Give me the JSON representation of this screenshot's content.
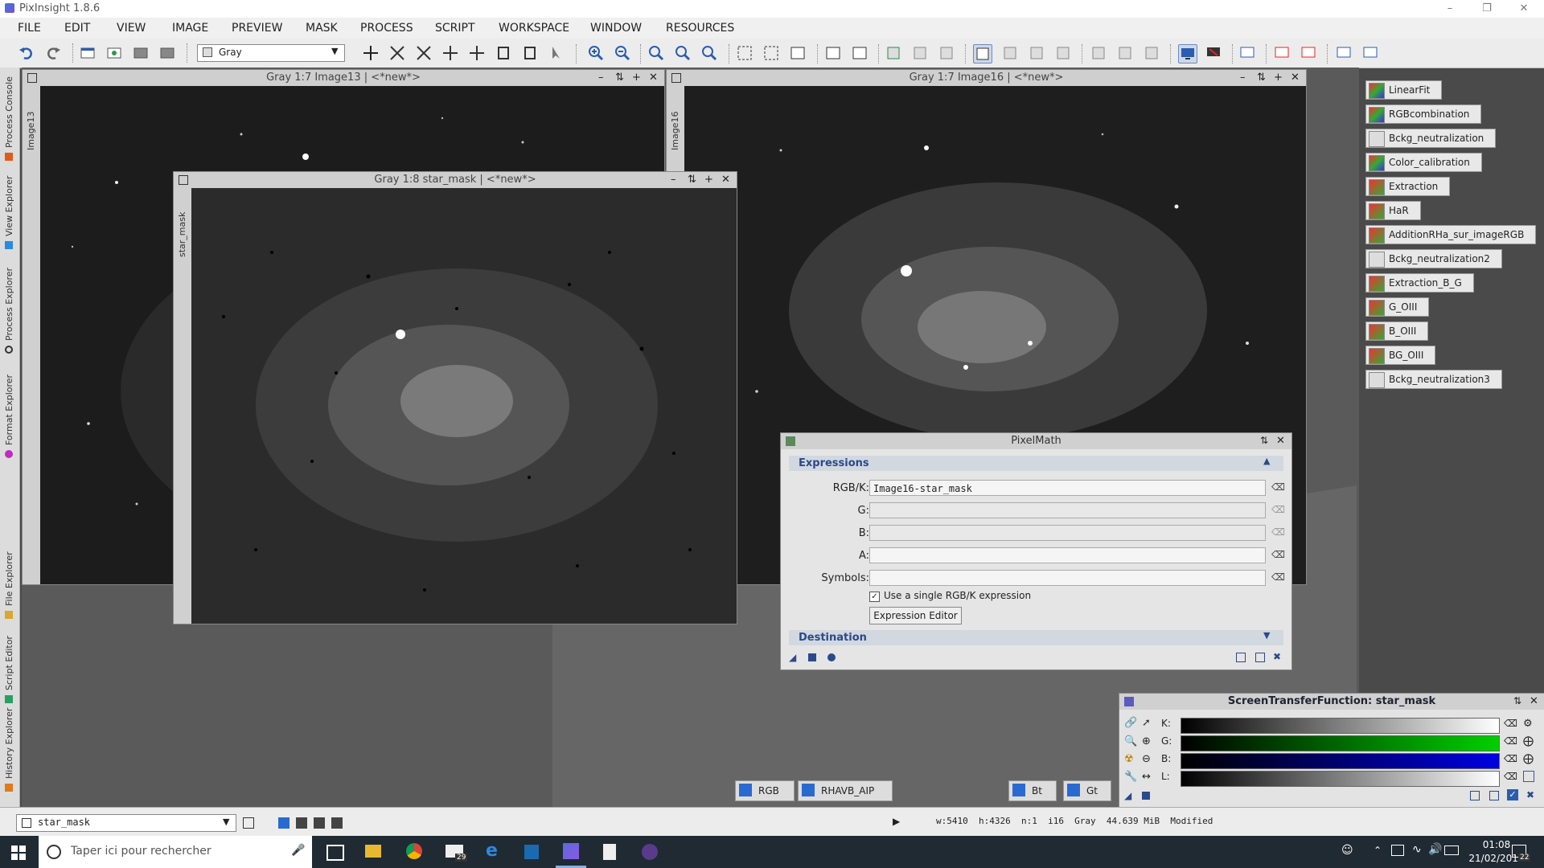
{
  "app": {
    "title": "PixInsight 1.8.6"
  },
  "menu": [
    "FILE",
    "EDIT",
    "VIEW",
    "IMAGE",
    "PREVIEW",
    "MASK",
    "PROCESS",
    "SCRIPT",
    "WORKSPACE",
    "WINDOW",
    "RESOURCES"
  ],
  "toolbar": {
    "display_select": "Gray"
  },
  "sidebar_tabs": [
    "Process Console",
    "View Explorer",
    "Process Explorer",
    "Format Explorer",
    "File Explorer",
    "Script Editor",
    "History Explorer"
  ],
  "windows": {
    "image13": {
      "title": "Gray 1:7 Image13 | <*new*>",
      "tab": "Image13"
    },
    "image16": {
      "title": "Gray 1:7 Image16 | <*new*>",
      "tab": "Image16"
    },
    "starmask": {
      "title": "Gray 1:8 star_mask | <*new*>",
      "tab": "star_mask"
    }
  },
  "process_icons": [
    "LinearFit",
    "RGBcombination",
    "Bckg_neutralization",
    "Color_calibration",
    "Extraction",
    "HaR",
    "AdditionRHa_sur_imageRGB",
    "Bckg_neutralization2",
    "Extraction_B_G",
    "G_OIII",
    "B_OIII",
    "BG_OIII",
    "Bckg_neutralization3"
  ],
  "pixelmath": {
    "title": "PixelMath",
    "expressions_label": "Expressions",
    "rows": [
      {
        "label": "RGB/K:",
        "value": "Image16-star_mask"
      },
      {
        "label": "G:",
        "value": ""
      },
      {
        "label": "B:",
        "value": ""
      },
      {
        "label": "A:",
        "value": ""
      },
      {
        "label": "Symbols:",
        "value": ""
      }
    ],
    "single_expr_label": "Use a single RGB/K expression",
    "single_expr_checked": true,
    "editor_button": "Expression Editor",
    "destination_label": "Destination"
  },
  "stf": {
    "title": "ScreenTransferFunction: star_mask",
    "channels": [
      {
        "label": "K:",
        "color": "#000000"
      },
      {
        "label": "G:",
        "color": "#00c000"
      },
      {
        "label": "B:",
        "color": "#0000c0"
      },
      {
        "label": "L:",
        "color": "#000000"
      }
    ]
  },
  "workspace_icons": [
    {
      "label": "RGB"
    },
    {
      "label": "RHAVB_AIP"
    },
    {
      "label": "Bt"
    },
    {
      "label": "Gt"
    }
  ],
  "status": {
    "view_select": "star_mask",
    "info": "w:5410  h:4326  n:1  i16  Gray  44.639 MiB  Modified"
  },
  "taskbar": {
    "search_placeholder": "Taper ici pour rechercher",
    "time": "01:08",
    "date": "21/02/2019",
    "mail_badge": "29",
    "notif_badge": "22"
  }
}
